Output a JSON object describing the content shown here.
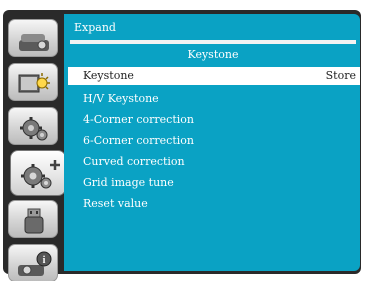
{
  "menu": {
    "header": "Expand",
    "subheader": "Keystone",
    "selected": {
      "label": "Keystone",
      "value": "Store"
    },
    "items": [
      {
        "label": "H/V Keystone"
      },
      {
        "label": "4-Corner correction"
      },
      {
        "label": "6-Corner correction"
      },
      {
        "label": "Curved correction"
      },
      {
        "label": "Grid image tune"
      },
      {
        "label": "Reset value"
      }
    ]
  },
  "sidebar": {
    "tabs": [
      {
        "icon": "projector-icon"
      },
      {
        "icon": "display-brightness-icon"
      },
      {
        "icon": "settings-gears-icon"
      },
      {
        "icon": "expand-settings-icon",
        "active": true
      },
      {
        "icon": "usb-memory-icon"
      },
      {
        "icon": "info-projector-icon"
      }
    ]
  },
  "colors": {
    "panel": "#0aa2c4",
    "frame": "#2a2a2a",
    "highlight": "#ffffff"
  }
}
